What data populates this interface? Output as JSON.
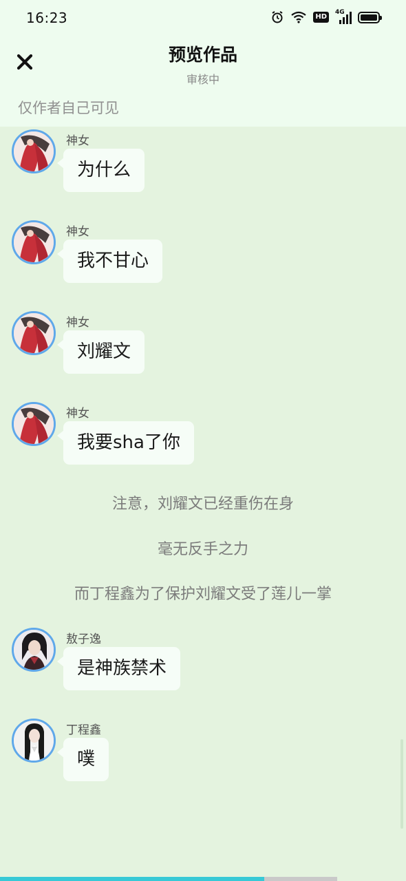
{
  "status_bar": {
    "time": "16:23",
    "icons": [
      "alarm-icon",
      "wifi-icon",
      "hd-icon",
      "4g-signal-icon",
      "battery-icon"
    ],
    "hd_label": "HD",
    "network_label": "4G"
  },
  "header": {
    "close_icon": "close-icon",
    "title": "预览作品",
    "subtitle": "审核中",
    "visibility_note": "仅作者自己可见"
  },
  "messages": [
    {
      "sender": "神女",
      "text": "为什么",
      "avatar": "red-robed-woman-avatar"
    },
    {
      "sender": "神女",
      "text": "我不甘心",
      "avatar": "red-robed-woman-avatar"
    },
    {
      "sender": "神女",
      "text": "刘耀文",
      "avatar": "red-robed-woman-avatar"
    },
    {
      "sender": "神女",
      "text": "我要sha了你",
      "avatar": "red-robed-woman-avatar"
    }
  ],
  "narrations": [
    "注意，刘耀文已经重伤在身",
    "毫无反手之力",
    "而丁程鑫为了保护刘耀文受了莲儿一掌"
  ],
  "messages_after": [
    {
      "sender": "敖子逸",
      "text": "是神族禁术",
      "avatar": "dark-haired-man-avatar"
    },
    {
      "sender": "丁程鑫",
      "text": "噗",
      "avatar": "long-haired-man-white-robe-avatar"
    }
  ],
  "colors": {
    "chat_background": "#e4f3df",
    "header_background": "#eefcef",
    "bubble": "#f6fdf7",
    "avatar_ring": "#5fa8ea",
    "progress": "#37c9d6"
  },
  "bottom_progress_fraction": 0.65,
  "bottom_progress_track_fraction": 0.83
}
